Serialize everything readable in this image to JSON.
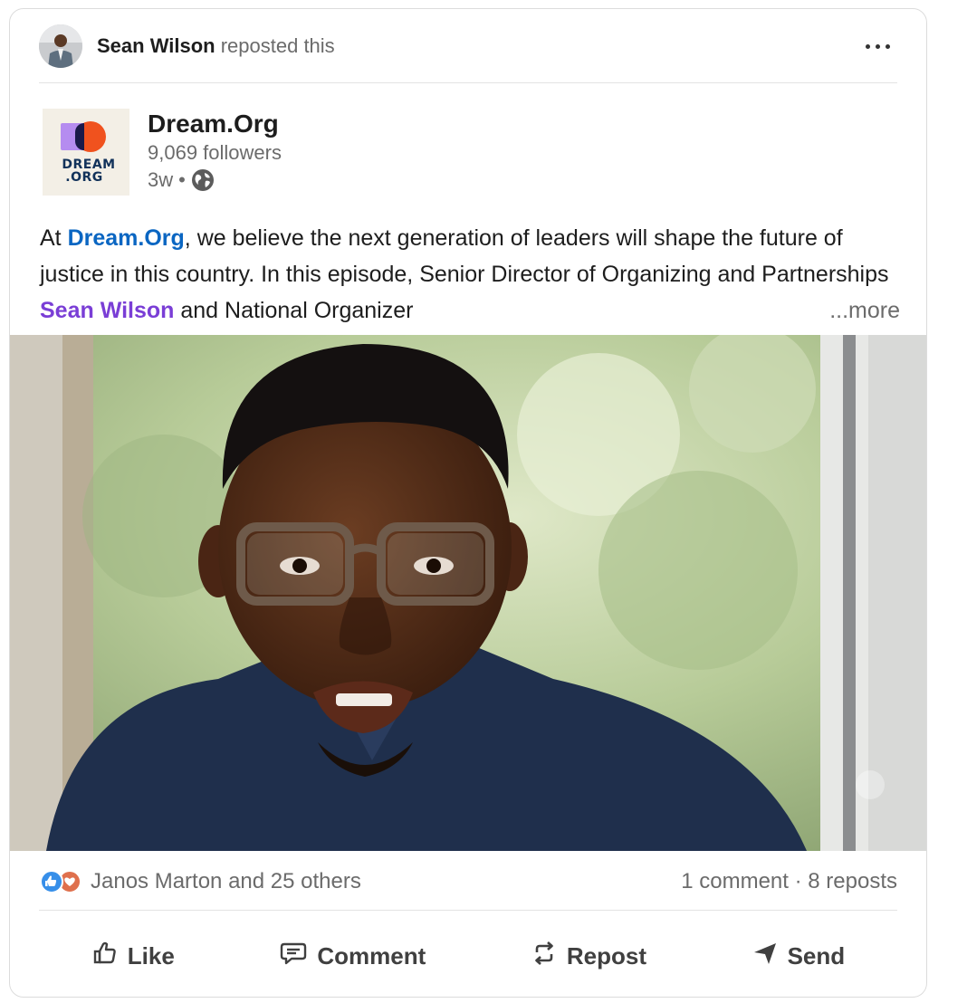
{
  "repost": {
    "name": "Sean Wilson",
    "action": " reposted this",
    "more_icon": "ellipsis-icon"
  },
  "author": {
    "logo_line1": "DREAM",
    "logo_line2": ".ORG",
    "name": "Dream.Org",
    "followers": "9,069 followers",
    "time": "3w",
    "separator": "•",
    "visibility_icon": "globe-icon"
  },
  "post": {
    "text_1": "At ",
    "mention_org": "Dream.Org",
    "text_2": ", we believe the next generation of leaders will shape the future of justice in this country. In this episode, Senior Director of Organizing and Partnerships ",
    "mention_person": "Sean Wilson",
    "text_3": " and National Organizer",
    "see_more": "...more"
  },
  "social": {
    "reactions_text": "Janos Marton and 25 others",
    "comments": "1 comment",
    "dot": " · ",
    "reposts": "8 reposts"
  },
  "actions": {
    "like": "Like",
    "comment": "Comment",
    "repost": "Repost",
    "send": "Send"
  },
  "colors": {
    "link_blue": "#0a66c2",
    "mention_purple": "#7a3ed6",
    "like_blue": "#378fe9",
    "love_red": "#df704d"
  }
}
